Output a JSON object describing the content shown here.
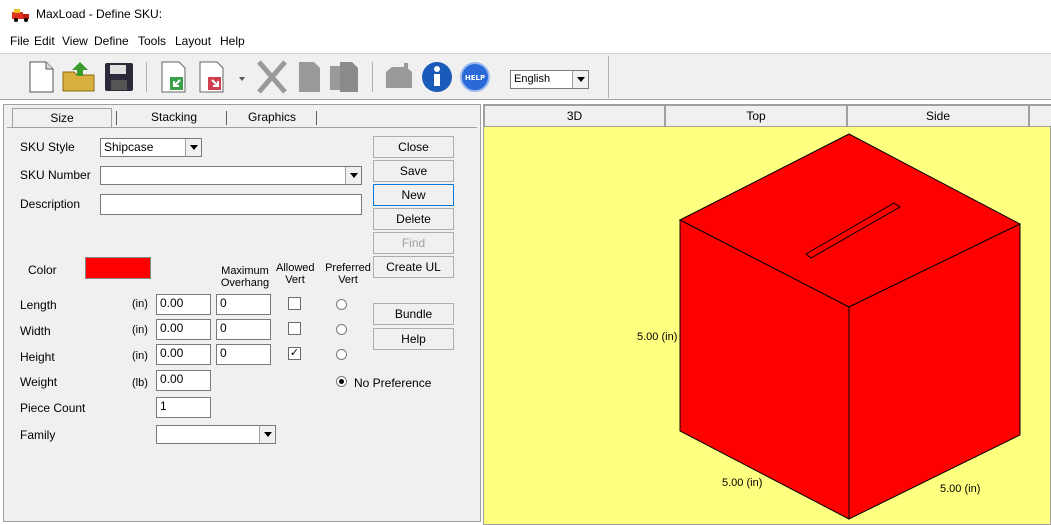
{
  "window": {
    "title": "MaxLoad - Define SKU:"
  },
  "menu": [
    "File",
    "Edit",
    "View",
    "Define",
    "Tools",
    "Layout",
    "Help"
  ],
  "toolbar": {
    "icons": [
      "new-file-icon",
      "open-folder-icon",
      "save-disk-icon",
      "import-icon",
      "export-icon",
      "cut-icon",
      "copy-icon",
      "paste-icon",
      "truck-icon",
      "info-icon",
      "help-icon"
    ],
    "language": "English",
    "help_badge": "HELP"
  },
  "tabs": [
    "Size",
    "Stacking",
    "Graphics"
  ],
  "form": {
    "sku_style_label": "SKU Style",
    "sku_style_value": "Shipcase",
    "sku_number_label": "SKU Number",
    "sku_number_value": "",
    "description_label": "Description",
    "description_value": "",
    "color_label": "Color",
    "color_value": "#ff0000",
    "headers": {
      "max_overhang": "Maximum Overhang",
      "allowed_vert": "Allowed Vert",
      "preferred_vert": "Preferred Vert"
    },
    "rows": [
      {
        "label": "Length",
        "unit": "(in)",
        "value": "0.00",
        "overhang": "0",
        "allowed": false
      },
      {
        "label": "Width",
        "unit": "(in)",
        "value": "0.00",
        "overhang": "0",
        "allowed": false
      },
      {
        "label": "Height",
        "unit": "(in)",
        "value": "0.00",
        "overhang": "0",
        "allowed": true
      }
    ],
    "weight_label": "Weight",
    "weight_unit": "(lb)",
    "weight_value": "0.00",
    "piece_count_label": "Piece Count",
    "piece_count_value": "1",
    "family_label": "Family",
    "family_value": "",
    "no_preference_label": "No Preference"
  },
  "buttons": {
    "close": "Close",
    "save": "Save",
    "new": "New",
    "delete": "Delete",
    "find": "Find",
    "create_ul": "Create UL",
    "bundle": "Bundle",
    "help": "Help"
  },
  "view": {
    "tabs": [
      "3D",
      "Top",
      "Side"
    ],
    "background": "#ffff80",
    "box_color": "#ff0000",
    "dim_height": "5.00 (in)",
    "dim_left": "5.00 (in)",
    "dim_right": "5.00 (in)"
  }
}
